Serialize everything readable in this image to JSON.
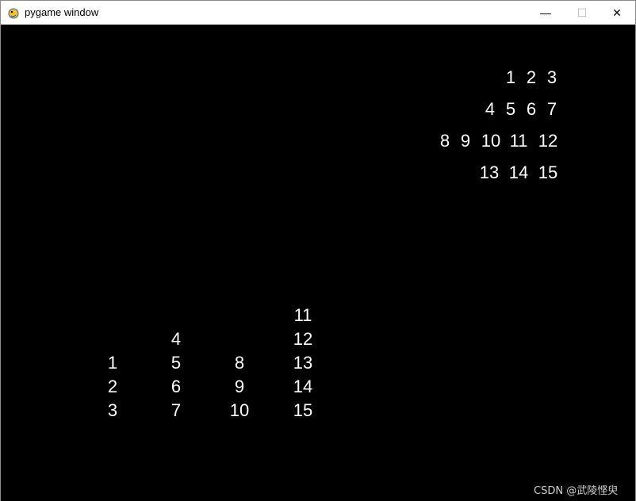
{
  "window": {
    "title": "pygame window",
    "icon": "pygame-snake-icon",
    "controls": {
      "minimize": "—",
      "maximize": "☐",
      "close": "✕"
    }
  },
  "game": {
    "background": "#000000",
    "text_color": "#ffffff",
    "top_right_rows": [
      [
        "1",
        "2",
        "3"
      ],
      [
        "4",
        "5",
        "6",
        "7"
      ],
      [
        "8",
        "9",
        "10",
        "11",
        "12"
      ],
      [
        "13",
        "14",
        "15"
      ]
    ],
    "bottom_left_columns": [
      [
        "1",
        "2",
        "3"
      ],
      [
        "4",
        "5",
        "6",
        "7"
      ],
      [
        "8",
        "9",
        "10"
      ],
      [
        "11",
        "12",
        "13",
        "14",
        "15"
      ]
    ]
  },
  "watermark": "CSDN @武陵悭臾"
}
